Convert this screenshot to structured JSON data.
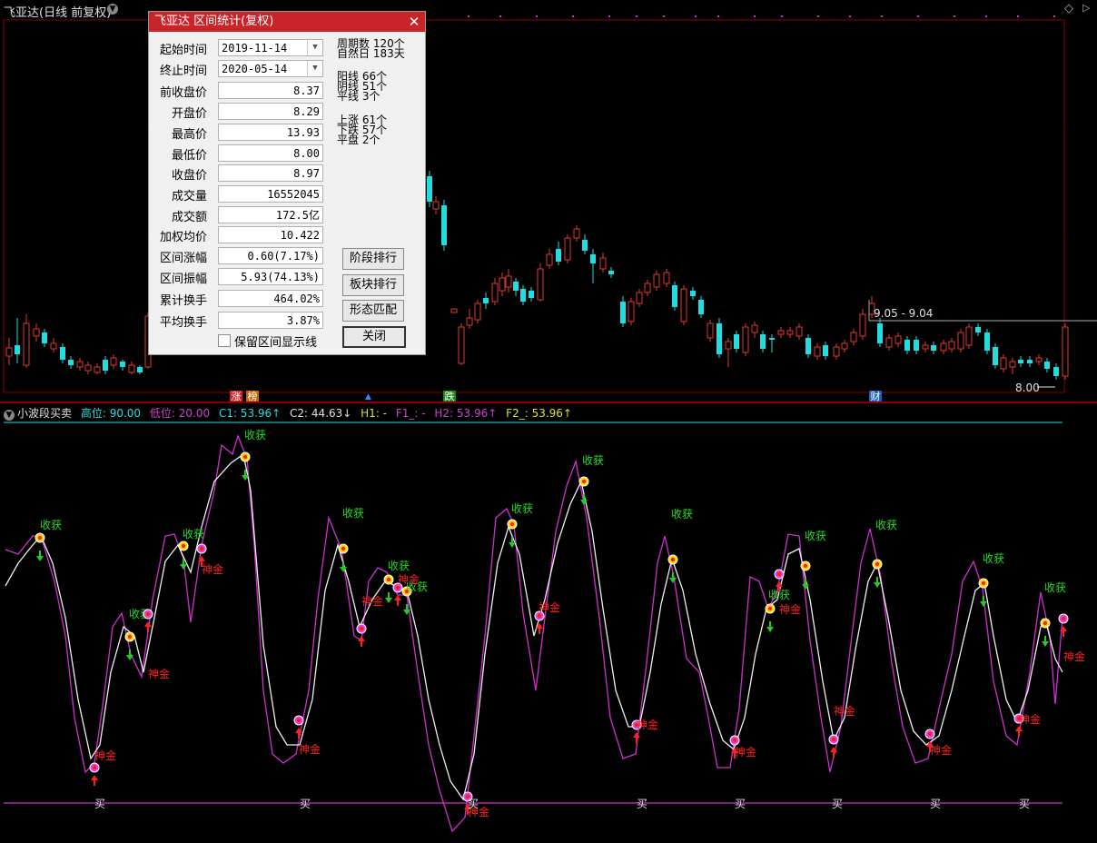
{
  "window": {
    "title": "飞亚达(日线 前复权)"
  },
  "dialog": {
    "title": "飞亚达 区间统计(复权)",
    "fields": [
      {
        "label": "起始时间",
        "value": "2019-11-14",
        "type": "date"
      },
      {
        "label": "终止时间",
        "value": "2020-05-14",
        "type": "date"
      },
      {
        "label": "前收盘价",
        "value": "8.37"
      },
      {
        "label": "开盘价",
        "value": "8.29"
      },
      {
        "label": "最高价",
        "value": "13.93"
      },
      {
        "label": "最低价",
        "value": "8.00"
      },
      {
        "label": "收盘价",
        "value": "8.97"
      },
      {
        "label": "成交量",
        "value": "16552045"
      },
      {
        "label": "成交额",
        "value": "172.5亿"
      },
      {
        "label": "加权均价",
        "value": "10.422"
      },
      {
        "label": "区间涨幅",
        "value": "0.60(7.17%)"
      },
      {
        "label": "区间振幅",
        "value": "5.93(74.13%)"
      },
      {
        "label": "累计换手",
        "value": "464.02%"
      },
      {
        "label": "平均换手",
        "value": "3.87%"
      }
    ],
    "stats": [
      {
        "label": "周期数",
        "value": "120个"
      },
      {
        "label": "自然日",
        "value": "183天"
      },
      {
        "label": "阳线",
        "value": "66个"
      },
      {
        "label": "阴线",
        "value": "51个"
      },
      {
        "label": "平线",
        "value": "3个"
      },
      {
        "label": "上涨",
        "value": "61个"
      },
      {
        "label": "下跌",
        "value": "57个"
      },
      {
        "label": "平盘",
        "value": "2个"
      }
    ],
    "buttons": [
      "阶段排行",
      "板块排行",
      "形态匹配",
      "关闭"
    ],
    "checkbox_label": "保留区间显示线"
  },
  "kline": {
    "range_label": "9.05 - 9.04",
    "low_label": "8.00",
    "badges": [
      {
        "text": "涨",
        "color": "#c8242a"
      },
      {
        "text": "榜",
        "color": "#c86400"
      },
      {
        "text": "跌",
        "color": "#1a8a1a"
      },
      {
        "text": "财",
        "color": "#2060c0"
      }
    ],
    "colors": {
      "up": "#e0392f",
      "down": "#22dde0",
      "frame": "#8a0000"
    }
  },
  "indicator": {
    "name": "小波段买卖",
    "params": [
      {
        "text": "高位: 90.00",
        "color": "#22dde0"
      },
      {
        "text": "低位: 20.00",
        "color": "#d040d0"
      },
      {
        "text": "C1: 53.96↑",
        "color": "#22dde0"
      },
      {
        "text": "C2: 44.63↓",
        "color": "#e0e0e0"
      },
      {
        "text": "H1: -",
        "color": "#e0e020"
      },
      {
        "text": "F1_: -",
        "color": "#d040d0"
      },
      {
        "text": "H2: 53.96↑",
        "color": "#d040d0"
      },
      {
        "text": "F2_: 53.96↑",
        "color": "#e0e020"
      }
    ],
    "sell_label": "收获",
    "buy_label": "神金",
    "bottom_label": "买",
    "colors": {
      "fast": "#d030d0",
      "slow": "#f0f0f0",
      "sell": "#22dd22",
      "buy": "#ff2020"
    }
  }
}
